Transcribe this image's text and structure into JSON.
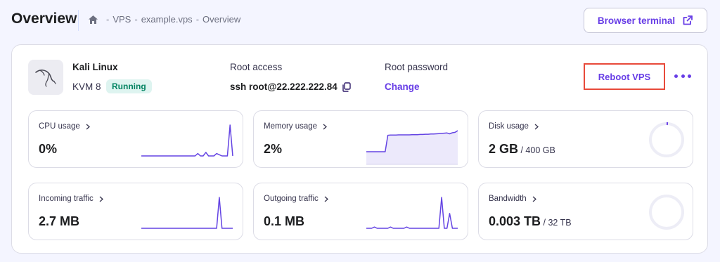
{
  "header": {
    "title": "Overview",
    "breadcrumb": [
      "VPS",
      "example.vps",
      "Overview"
    ],
    "terminal_button": "Browser terminal"
  },
  "server": {
    "os_name": "Kali Linux",
    "plan": "KVM 8",
    "status": "Running",
    "root_access_label": "Root access",
    "root_access_value": "ssh root@22.222.222.84",
    "root_password_label": "Root password",
    "change_label": "Change",
    "reboot_label": "Reboot VPS"
  },
  "tiles": [
    {
      "label": "CPU usage",
      "value": "0%",
      "unit": "",
      "kind": "spark",
      "series": [
        0,
        0,
        0,
        0,
        0,
        0,
        0,
        0,
        0,
        0,
        0,
        0,
        0,
        0,
        0,
        0,
        0,
        0,
        0,
        0,
        0,
        0.2,
        0,
        0,
        0.3,
        0,
        0,
        0,
        0.2,
        0.1,
        0,
        0,
        0,
        2.6,
        0
      ]
    },
    {
      "label": "Memory usage",
      "value": "2%",
      "unit": "",
      "kind": "area",
      "series": [
        2,
        2,
        2,
        2,
        2,
        2,
        2,
        2,
        9.8,
        9.9,
        9.9,
        9.9,
        10,
        10,
        10,
        10,
        10,
        10.1,
        10.1,
        10.1,
        10.2,
        10.2,
        10.3,
        10.3,
        10.4,
        10.4,
        10.5,
        10.6,
        10.7,
        10.8,
        10.9,
        10.5,
        11,
        11.2,
        12
      ]
    },
    {
      "label": "Disk usage",
      "value": "2 GB",
      "unit": " / 400 GB",
      "kind": "ring",
      "fraction": 0.005
    },
    {
      "label": "Incoming traffic",
      "value": "2.7 MB",
      "unit": "",
      "kind": "spark",
      "series": [
        0,
        0,
        0,
        0,
        0,
        0,
        0,
        0,
        0,
        0,
        0,
        0,
        0,
        0,
        0,
        0,
        0,
        0,
        0,
        0,
        0,
        0,
        0,
        0,
        0,
        0,
        0,
        0,
        0,
        10,
        0,
        0,
        0,
        0,
        0
      ]
    },
    {
      "label": "Outgoing traffic",
      "value": "0.1 MB",
      "unit": "",
      "kind": "spark",
      "series": [
        0,
        0,
        0,
        0.1,
        0,
        0,
        0,
        0,
        0,
        0.1,
        0,
        0,
        0,
        0,
        0,
        0.1,
        0,
        0,
        0,
        0,
        0,
        0,
        0,
        0,
        0,
        0,
        0,
        0,
        2.5,
        0,
        0,
        1.2,
        0,
        0,
        0
      ]
    },
    {
      "label": "Bandwidth",
      "value": "0.003 TB",
      "unit": " / 32 TB",
      "kind": "ring",
      "fraction": 0.0001
    }
  ],
  "colors": {
    "accent": "#673de6",
    "spark_line": "#6444e3",
    "area_fill": "#ece9fb",
    "ring_track": "#ededf6",
    "running_bg": "#def4f0",
    "running_text": "#008361",
    "highlight_border": "#e84a3a"
  },
  "icons": {
    "home": "home-icon",
    "external": "external-link-icon",
    "copy": "copy-icon",
    "chevron": "chevron-right-icon",
    "more": "more-dots-icon",
    "os_logo": "kali-dragon-logo"
  }
}
